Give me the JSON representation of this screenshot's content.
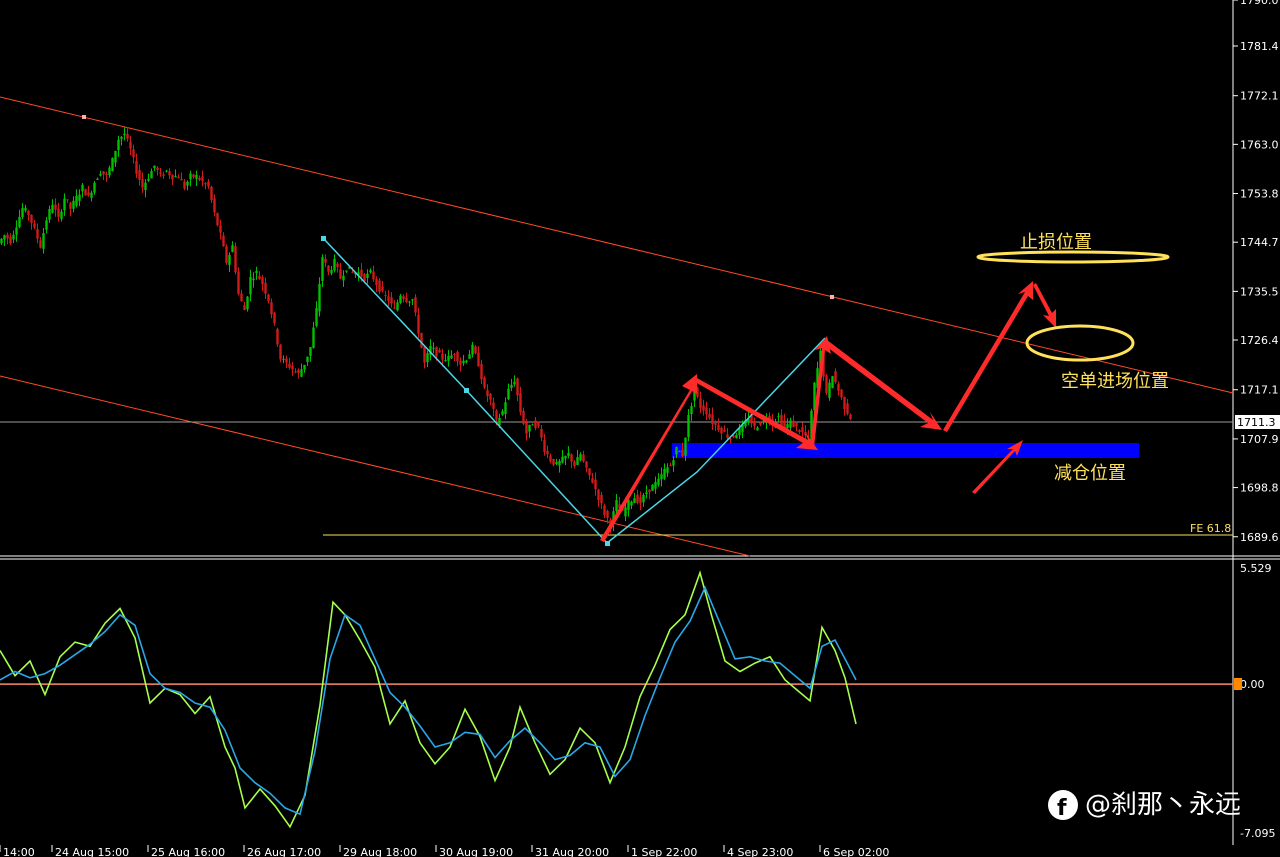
{
  "chart_data": [
    {
      "type": "candlestick",
      "title": "",
      "y_ticks": [
        "1790.0",
        "1781.4",
        "1772.1",
        "1763.0",
        "1753.8",
        "1744.7",
        "1735.5",
        "1726.4",
        "1717.1",
        "1707.9",
        "1698.8",
        "1689.6"
      ],
      "y_range": [
        1686.0,
        1790.0
      ],
      "current_price": "1711.3",
      "x_ticks": [
        "14:00",
        "24 Aug 15:00",
        "25 Aug 16:00",
        "26 Aug 17:00",
        "29 Aug 18:00",
        "30 Aug 19:00",
        "31 Aug 20:00",
        "1 Sep 22:00",
        "4 Sep 23:00",
        "6 Sep 02:00"
      ],
      "fib_level": {
        "label": "FE 61.8",
        "value": 1691.2
      },
      "annotations": {
        "stop_loss": "止损位置",
        "short_entry": "空单进场位置",
        "reduce_position": "减仓位置"
      },
      "colors": {
        "up": "#00c000",
        "down": "#d11a1a",
        "trendline": "#ff4a2a",
        "zigzag": "#4ad7e6",
        "zone": "#0000ff",
        "arrow": "#ff2b2b",
        "annotation": "#ffe15a"
      },
      "close_path": [
        [
          0,
          1744.5
        ],
        [
          6,
          1746
        ],
        [
          12,
          1745
        ],
        [
          18,
          1748
        ],
        [
          24,
          1751
        ],
        [
          30,
          1750
        ],
        [
          36,
          1747
        ],
        [
          42,
          1744
        ],
        [
          48,
          1749
        ],
        [
          54,
          1752
        ],
        [
          60,
          1749
        ],
        [
          66,
          1753
        ],
        [
          72,
          1751
        ],
        [
          78,
          1753
        ],
        [
          84,
          1755
        ],
        [
          90,
          1753
        ],
        [
          96,
          1756
        ],
        [
          102,
          1758
        ],
        [
          108,
          1757
        ],
        [
          114,
          1760
        ],
        [
          120,
          1764
        ],
        [
          126,
          1765
        ],
        [
          132,
          1762
        ],
        [
          138,
          1758
        ],
        [
          144,
          1755
        ],
        [
          150,
          1757
        ],
        [
          156,
          1759
        ],
        [
          162,
          1757
        ],
        [
          168,
          1758
        ],
        [
          174,
          1757
        ],
        [
          180,
          1757
        ],
        [
          186,
          1755
        ],
        [
          192,
          1757
        ],
        [
          198,
          1757
        ],
        [
          204,
          1756
        ],
        [
          210,
          1755
        ],
        [
          216,
          1750
        ],
        [
          222,
          1746
        ],
        [
          228,
          1741
        ],
        [
          234,
          1744
        ],
        [
          240,
          1735
        ],
        [
          246,
          1732
        ],
        [
          252,
          1738
        ],
        [
          258,
          1739
        ],
        [
          264,
          1737
        ],
        [
          270,
          1734
        ],
        [
          276,
          1729
        ],
        [
          282,
          1723
        ],
        [
          288,
          1722
        ],
        [
          294,
          1721
        ],
        [
          300,
          1720
        ],
        [
          306,
          1722
        ],
        [
          312,
          1725
        ],
        [
          318,
          1732
        ],
        [
          324,
          1742
        ],
        [
          330,
          1739
        ],
        [
          336,
          1741
        ],
        [
          342,
          1738
        ],
        [
          348,
          1740
        ],
        [
          354,
          1739
        ],
        [
          360,
          1739
        ],
        [
          366,
          1738
        ],
        [
          372,
          1739
        ],
        [
          378,
          1737
        ],
        [
          384,
          1735
        ],
        [
          390,
          1734
        ],
        [
          396,
          1732
        ],
        [
          402,
          1735
        ],
        [
          408,
          1734
        ],
        [
          414,
          1734
        ],
        [
          420,
          1728
        ],
        [
          426,
          1722
        ],
        [
          432,
          1725
        ],
        [
          438,
          1724
        ],
        [
          444,
          1723
        ],
        [
          450,
          1723
        ],
        [
          456,
          1724
        ],
        [
          462,
          1722
        ],
        [
          468,
          1723
        ],
        [
          474,
          1725
        ],
        [
          480,
          1722
        ],
        [
          486,
          1717
        ],
        [
          492,
          1715
        ],
        [
          498,
          1711
        ],
        [
          504,
          1713
        ],
        [
          510,
          1717
        ],
        [
          516,
          1719
        ],
        [
          522,
          1713
        ],
        [
          528,
          1709
        ],
        [
          534,
          1711
        ],
        [
          540,
          1710
        ],
        [
          546,
          1706
        ],
        [
          552,
          1704
        ],
        [
          558,
          1703
        ],
        [
          564,
          1704
        ],
        [
          570,
          1705
        ],
        [
          576,
          1703
        ],
        [
          582,
          1705
        ],
        [
          588,
          1702
        ],
        [
          594,
          1700
        ],
        [
          600,
          1697
        ],
        [
          606,
          1694
        ],
        [
          612,
          1692
        ],
        [
          618,
          1696
        ],
        [
          624,
          1694
        ],
        [
          630,
          1696
        ],
        [
          636,
          1697
        ],
        [
          642,
          1696
        ],
        [
          648,
          1698
        ],
        [
          654,
          1699
        ],
        [
          660,
          1700
        ],
        [
          666,
          1702
        ],
        [
          672,
          1703
        ],
        [
          678,
          1706
        ],
        [
          684,
          1705
        ],
        [
          690,
          1712
        ],
        [
          696,
          1717
        ],
        [
          702,
          1714
        ],
        [
          708,
          1713
        ],
        [
          714,
          1711
        ],
        [
          720,
          1710
        ],
        [
          726,
          1709
        ],
        [
          732,
          1708
        ],
        [
          738,
          1709
        ],
        [
          744,
          1710
        ],
        [
          750,
          1712
        ],
        [
          756,
          1710
        ],
        [
          762,
          1711
        ],
        [
          768,
          1712
        ],
        [
          774,
          1711
        ],
        [
          780,
          1712
        ],
        [
          786,
          1710
        ],
        [
          792,
          1711
        ],
        [
          798,
          1710
        ],
        [
          804,
          1709
        ],
        [
          810,
          1708
        ],
        [
          816,
          1718
        ],
        [
          822,
          1724
        ],
        [
          828,
          1716
        ],
        [
          834,
          1720
        ],
        [
          840,
          1717
        ],
        [
          846,
          1714
        ],
        [
          852,
          1712
        ]
      ]
    },
    {
      "type": "line",
      "title": "",
      "y_ticks": [
        "5.529",
        "0.00",
        "-7.095"
      ],
      "y_range": [
        -7.095,
        5.529
      ],
      "zero_line": 0.0,
      "series": [
        {
          "color": "#a6ff4d",
          "values": [
            [
              0,
              1.6
            ],
            [
              15,
              0.4
            ],
            [
              30,
              1.1
            ],
            [
              45,
              -0.5
            ],
            [
              60,
              1.3
            ],
            [
              75,
              2.0
            ],
            [
              90,
              1.8
            ],
            [
              105,
              2.9
            ],
            [
              120,
              3.6
            ],
            [
              135,
              2.2
            ],
            [
              150,
              -0.9
            ],
            [
              165,
              -0.2
            ],
            [
              180,
              -0.5
            ],
            [
              195,
              -1.4
            ],
            [
              210,
              -0.6
            ],
            [
              225,
              -3.0
            ],
            [
              235,
              -4.0
            ],
            [
              245,
              -5.9
            ],
            [
              260,
              -5.0
            ],
            [
              275,
              -5.8
            ],
            [
              290,
              -6.8
            ],
            [
              305,
              -5.3
            ],
            [
              320,
              -1.0
            ],
            [
              333,
              3.9
            ],
            [
              345,
              3.3
            ],
            [
              360,
              2.1
            ],
            [
              375,
              0.8
            ],
            [
              390,
              -1.9
            ],
            [
              405,
              -0.8
            ],
            [
              420,
              -2.8
            ],
            [
              435,
              -3.8
            ],
            [
              450,
              -3.0
            ],
            [
              465,
              -1.2
            ],
            [
              480,
              -2.5
            ],
            [
              495,
              -4.6
            ],
            [
              510,
              -3.0
            ],
            [
              520,
              -1.1
            ],
            [
              535,
              -2.8
            ],
            [
              550,
              -4.3
            ],
            [
              565,
              -3.6
            ],
            [
              580,
              -2.1
            ],
            [
              595,
              -2.8
            ],
            [
              610,
              -4.7
            ],
            [
              625,
              -3.0
            ],
            [
              640,
              -0.6
            ],
            [
              655,
              0.9
            ],
            [
              670,
              2.6
            ],
            [
              685,
              3.3
            ],
            [
              700,
              5.3
            ],
            [
              712,
              3.2
            ],
            [
              725,
              1.1
            ],
            [
              740,
              0.6
            ],
            [
              755,
              1.0
            ],
            [
              770,
              1.3
            ],
            [
              785,
              0.2
            ],
            [
              800,
              -0.4
            ],
            [
              810,
              -0.8
            ],
            [
              822,
              2.7
            ],
            [
              835,
              1.6
            ],
            [
              845,
              0.3
            ],
            [
              856,
              -1.9
            ]
          ]
        },
        {
          "color": "#29a7e8",
          "values": [
            [
              0,
              0.2
            ],
            [
              15,
              0.6
            ],
            [
              30,
              0.3
            ],
            [
              45,
              0.5
            ],
            [
              60,
              0.9
            ],
            [
              75,
              1.4
            ],
            [
              90,
              1.9
            ],
            [
              105,
              2.5
            ],
            [
              120,
              3.3
            ],
            [
              135,
              2.8
            ],
            [
              150,
              0.5
            ],
            [
              165,
              -0.2
            ],
            [
              180,
              -0.4
            ],
            [
              195,
              -0.9
            ],
            [
              210,
              -1.1
            ],
            [
              225,
              -2.2
            ],
            [
              240,
              -4.0
            ],
            [
              255,
              -4.7
            ],
            [
              270,
              -5.2
            ],
            [
              285,
              -5.9
            ],
            [
              300,
              -6.2
            ],
            [
              315,
              -3.2
            ],
            [
              330,
              1.2
            ],
            [
              345,
              3.3
            ],
            [
              360,
              2.8
            ],
            [
              375,
              1.2
            ],
            [
              390,
              -0.4
            ],
            [
              405,
              -1.1
            ],
            [
              420,
              -2.0
            ],
            [
              435,
              -3.0
            ],
            [
              450,
              -2.8
            ],
            [
              465,
              -2.3
            ],
            [
              480,
              -2.4
            ],
            [
              495,
              -3.5
            ],
            [
              510,
              -2.7
            ],
            [
              525,
              -2.1
            ],
            [
              540,
              -2.8
            ],
            [
              555,
              -3.6
            ],
            [
              570,
              -3.4
            ],
            [
              585,
              -2.8
            ],
            [
              600,
              -3.0
            ],
            [
              615,
              -4.4
            ],
            [
              630,
              -3.6
            ],
            [
              645,
              -1.5
            ],
            [
              660,
              0.3
            ],
            [
              675,
              2.0
            ],
            [
              690,
              3.0
            ],
            [
              705,
              4.6
            ],
            [
              720,
              2.9
            ],
            [
              735,
              1.2
            ],
            [
              750,
              1.3
            ],
            [
              765,
              1.1
            ],
            [
              780,
              1.0
            ],
            [
              795,
              0.4
            ],
            [
              810,
              -0.2
            ],
            [
              822,
              1.8
            ],
            [
              835,
              2.1
            ],
            [
              845,
              1.2
            ],
            [
              856,
              0.2
            ]
          ]
        }
      ]
    }
  ],
  "watermark": {
    "text": "@刹那丶永远",
    "icon": "facebook-icon"
  }
}
